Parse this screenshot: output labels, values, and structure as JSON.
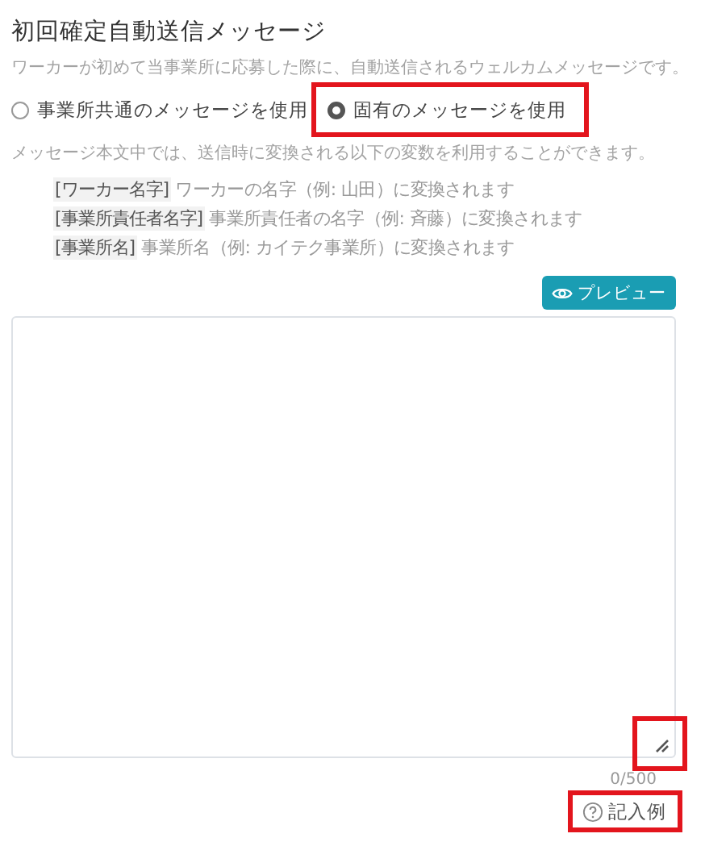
{
  "title": "初回確定自動送信メッセージ",
  "description": "ワーカーが初めて当事業所に応募した際に、自動送信されるウェルカムメッセージです。",
  "message_options": [
    {
      "label": "事業所共通のメッセージを使用",
      "selected": false,
      "highlighted": false
    },
    {
      "label": "固有のメッセージを使用",
      "selected": true,
      "highlighted": true
    }
  ],
  "variables_note": "メッセージ本文中では、送信時に変換される以下の変数を利用することができます。",
  "variables": [
    {
      "tag": "[ワーカー名字]",
      "text": "ワーカーの名字（例: 山田）に変換されます"
    },
    {
      "tag": "[事業所責任者名字]",
      "text": "事業所責任者の名字（例: 斉藤）に変換されます"
    },
    {
      "tag": "[事業所名]",
      "text": "事業所名（例: カイテク事業所）に変換されます"
    }
  ],
  "preview_button": "プレビュー",
  "message_box": {
    "resize_highlighted": true
  },
  "counter": "0/500",
  "example_link": {
    "label": "記入例",
    "highlighted": true
  }
}
